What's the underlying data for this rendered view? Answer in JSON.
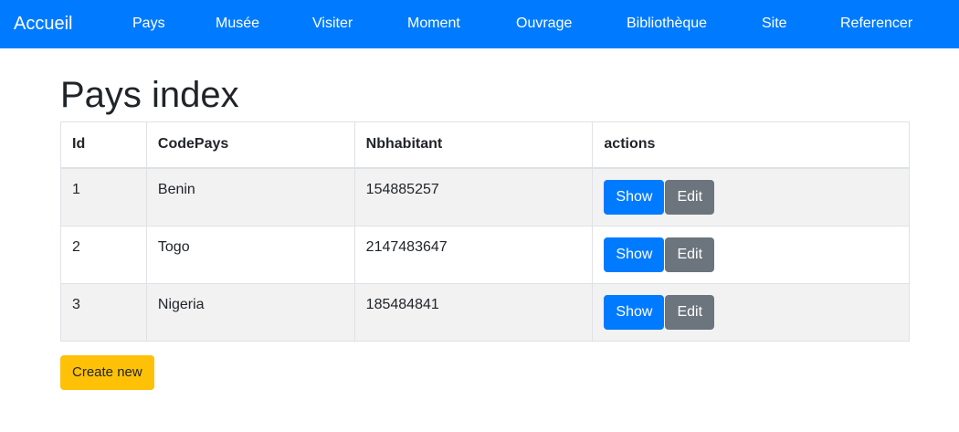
{
  "navbar": {
    "brand": "Accueil",
    "links": [
      {
        "label": "Pays"
      },
      {
        "label": "Musée"
      },
      {
        "label": "Visiter"
      },
      {
        "label": "Moment"
      },
      {
        "label": "Ouvrage"
      },
      {
        "label": "Bibliothèque"
      },
      {
        "label": "Site"
      },
      {
        "label": "Referencer"
      }
    ]
  },
  "page": {
    "title": "Pays index"
  },
  "table": {
    "headers": [
      "Id",
      "CodePays",
      "Nbhabitant",
      "actions"
    ],
    "rows": [
      {
        "id": "1",
        "code": "Benin",
        "nbhabitant": "154885257",
        "show": "Show",
        "edit": "Edit"
      },
      {
        "id": "2",
        "code": "Togo",
        "nbhabitant": "2147483647",
        "show": "Show",
        "edit": "Edit"
      },
      {
        "id": "3",
        "code": "Nigeria",
        "nbhabitant": "185484841",
        "show": "Show",
        "edit": "Edit"
      }
    ]
  },
  "actions": {
    "create_label": "Create new"
  },
  "colors": {
    "primary": "#007bff",
    "secondary": "#6c757d",
    "warning": "#ffc107",
    "striped_row": "#f2f2f2"
  }
}
